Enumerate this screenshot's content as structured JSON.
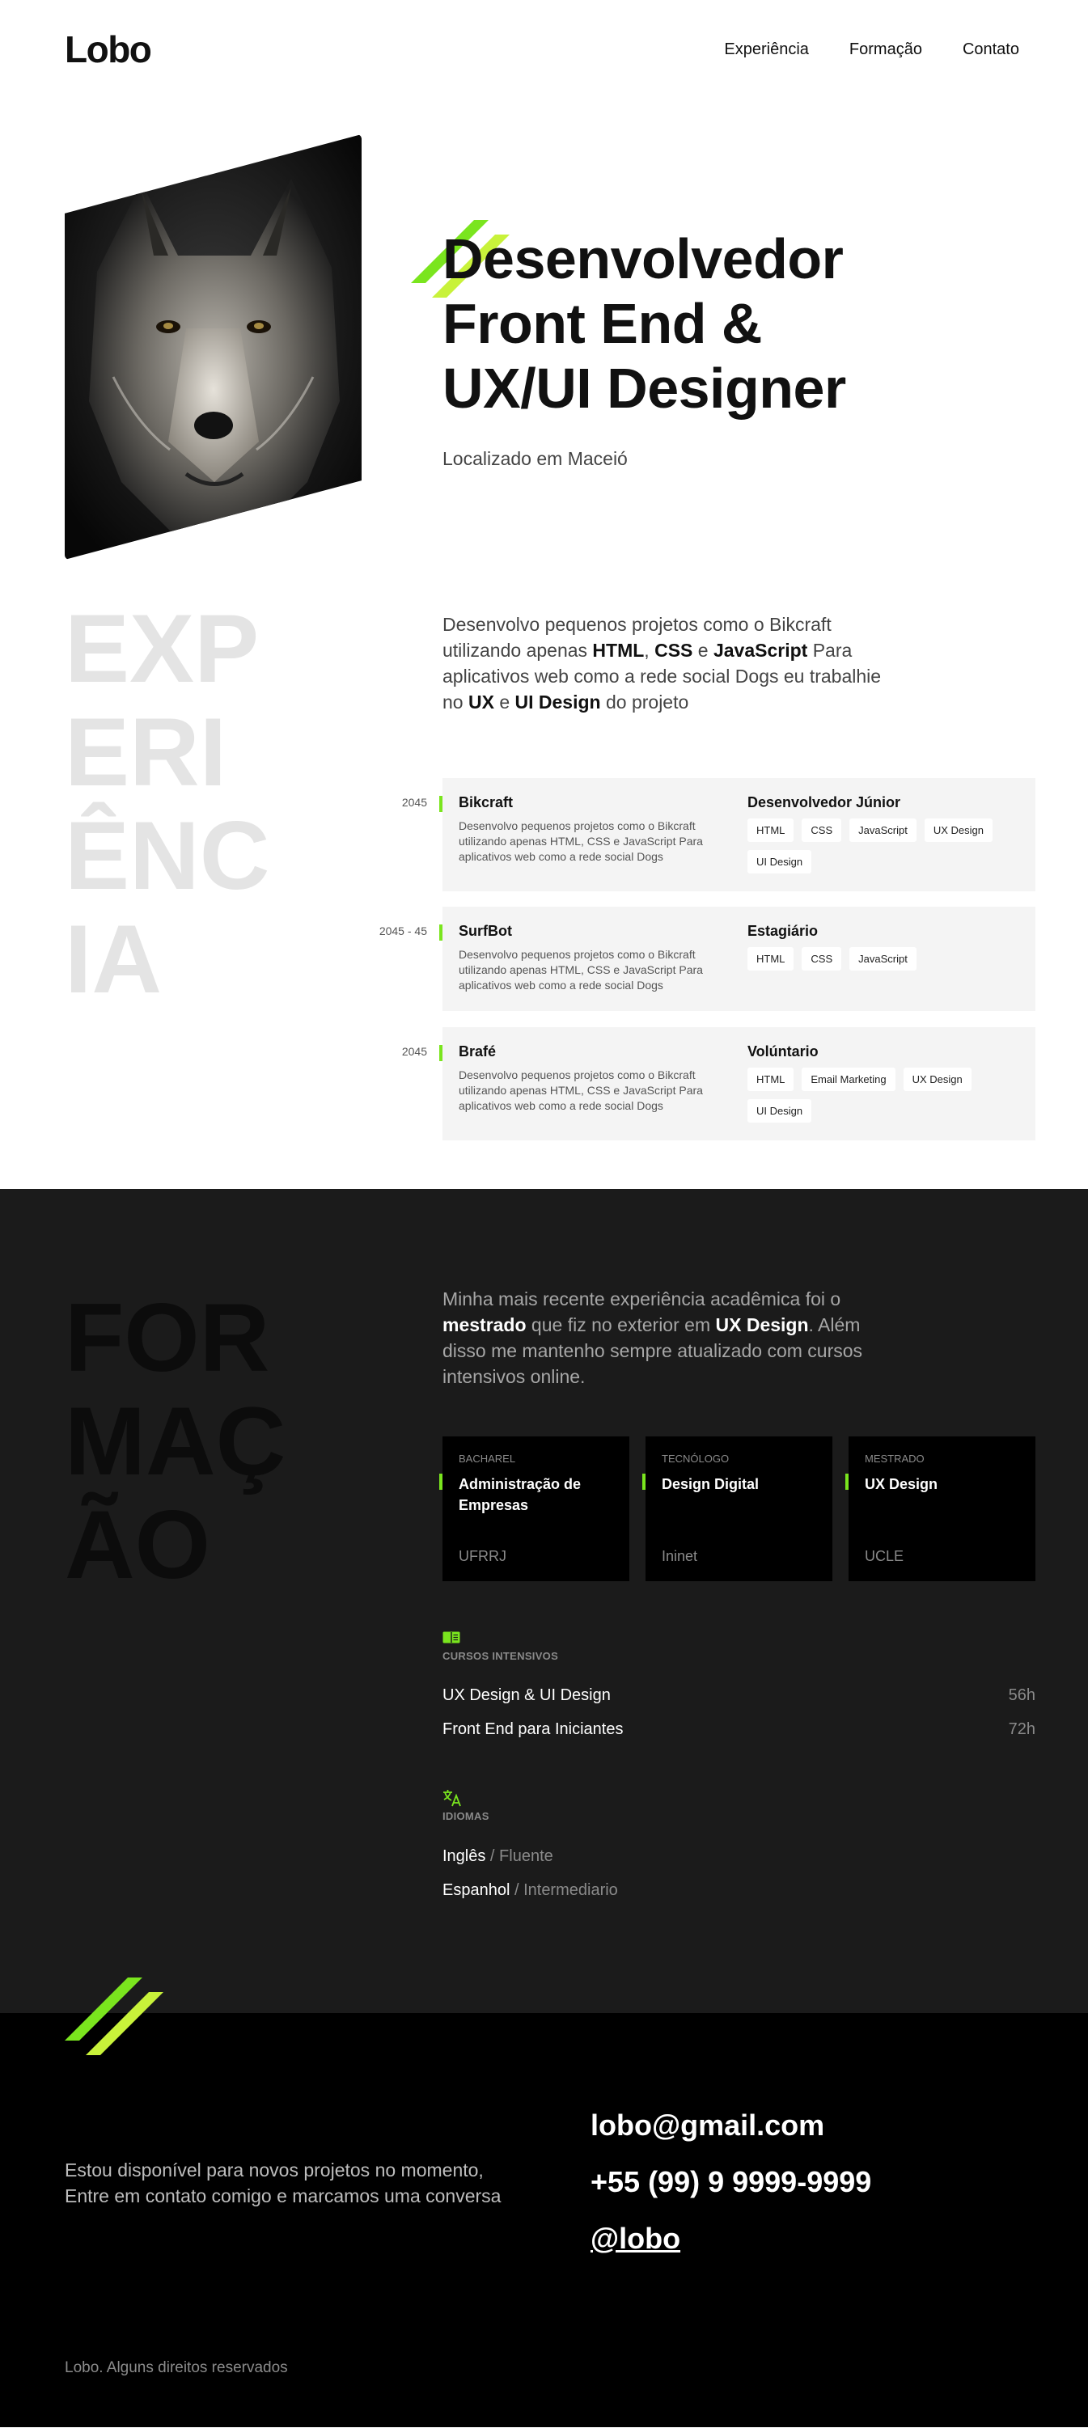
{
  "brand": {
    "logo": "Lobo"
  },
  "nav": [
    {
      "label": "Experiência"
    },
    {
      "label": "Formação"
    },
    {
      "label": "Contato"
    }
  ],
  "hero": {
    "title_lines": [
      "Desenvolvedor",
      "Front End &",
      "UX/UI Designer"
    ],
    "location": "Localizado em Maceió"
  },
  "experience": {
    "big_word": [
      "EXP",
      "ERI",
      "ÊNC",
      "IA"
    ],
    "intro": [
      {
        "t": "Desenvolvo pequenos projetos como o Bikcraft utilizando apenas ",
        "b": false
      },
      {
        "t": "HTML",
        "b": true
      },
      {
        "t": ", ",
        "b": false
      },
      {
        "t": "CSS",
        "b": true
      },
      {
        "t": " e ",
        "b": false
      },
      {
        "t": "JavaScript",
        "b": true
      },
      {
        "t": " Para aplicativos web como a rede social Dogs eu trabalhie no ",
        "b": false
      },
      {
        "t": "UX",
        "b": true
      },
      {
        "t": " e ",
        "b": false
      },
      {
        "t": "UI Design",
        "b": true
      },
      {
        "t": " do projeto",
        "b": false
      }
    ],
    "jobs": [
      {
        "year": "2045",
        "company": "Bikcraft",
        "desc": "Desenvolvo pequenos projetos como o Bikcraft utilizando apenas HTML, CSS e JavaScript Para aplicativos web como a rede social Dogs",
        "role": "Desenvolvedor Júnior",
        "tags": [
          "HTML",
          "CSS",
          "JavaScript",
          "UX Design",
          "UI Design"
        ]
      },
      {
        "year": "2045 - 45",
        "company": "SurfBot",
        "desc": "Desenvolvo pequenos projetos como o Bikcraft utilizando apenas HTML, CSS e JavaScript Para aplicativos web como a rede social Dogs",
        "role": "Estagiário",
        "tags": [
          "HTML",
          "CSS",
          "JavaScript"
        ]
      },
      {
        "year": "2045",
        "company": "Brafé",
        "desc": "Desenvolvo pequenos projetos como o Bikcraft utilizando apenas HTML, CSS e JavaScript Para aplicativos web como a rede social Dogs",
        "role": "Volúntario",
        "tags": [
          "HTML",
          "Email Marketing",
          "UX Design",
          "UI Design"
        ]
      }
    ]
  },
  "education": {
    "big_word": [
      "FOR",
      "MAÇ",
      "ÃO"
    ],
    "intro": [
      {
        "t": "Minha mais recente experiência acadêmica foi o ",
        "b": false
      },
      {
        "t": "mestrado",
        "b": true
      },
      {
        "t": " que fiz no exterior em ",
        "b": false
      },
      {
        "t": "UX Design",
        "b": true
      },
      {
        "t": ". Além disso me mantenho sempre atualizado com cursos intensivos online.",
        "b": false
      }
    ],
    "degrees": [
      {
        "type": "BACHAREL",
        "name": "Administração de Empresas",
        "institution": "UFRRJ"
      },
      {
        "type": "TECNÓLOGO",
        "name": "Design Digital",
        "institution": "Ininet"
      },
      {
        "type": "MESTRADO",
        "name": "UX Design",
        "institution": "UCLE"
      }
    ],
    "courses_label": "CURSOS INTENSIVOS",
    "courses": [
      {
        "name": "UX Design & UI Design",
        "duration": "56h"
      },
      {
        "name": "Front End para Iniciantes",
        "duration": "72h"
      }
    ],
    "languages_label": "IDIOMAS",
    "languages": [
      {
        "name": "Inglês",
        "level": " / Fluente"
      },
      {
        "name": "Espanhol",
        "level": " / Intermediario"
      }
    ]
  },
  "contact": {
    "text": "Estou disponível para novos projetos no momento, Entre em contato comigo e marcamos uma conversa",
    "email": "lobo@gmail.com",
    "phone": "+55 (99) 9 9999-9999",
    "handle": "@lobo",
    "footer": "Lobo. Alguns direitos reservados"
  },
  "colors": {
    "accent": "#7ae51e",
    "accent_light": "#c8f23a",
    "dark_section": "#1b1b1b",
    "contact_bg": "#000000"
  },
  "icons": {
    "courses": "book-icon",
    "languages": "translate-icon"
  }
}
